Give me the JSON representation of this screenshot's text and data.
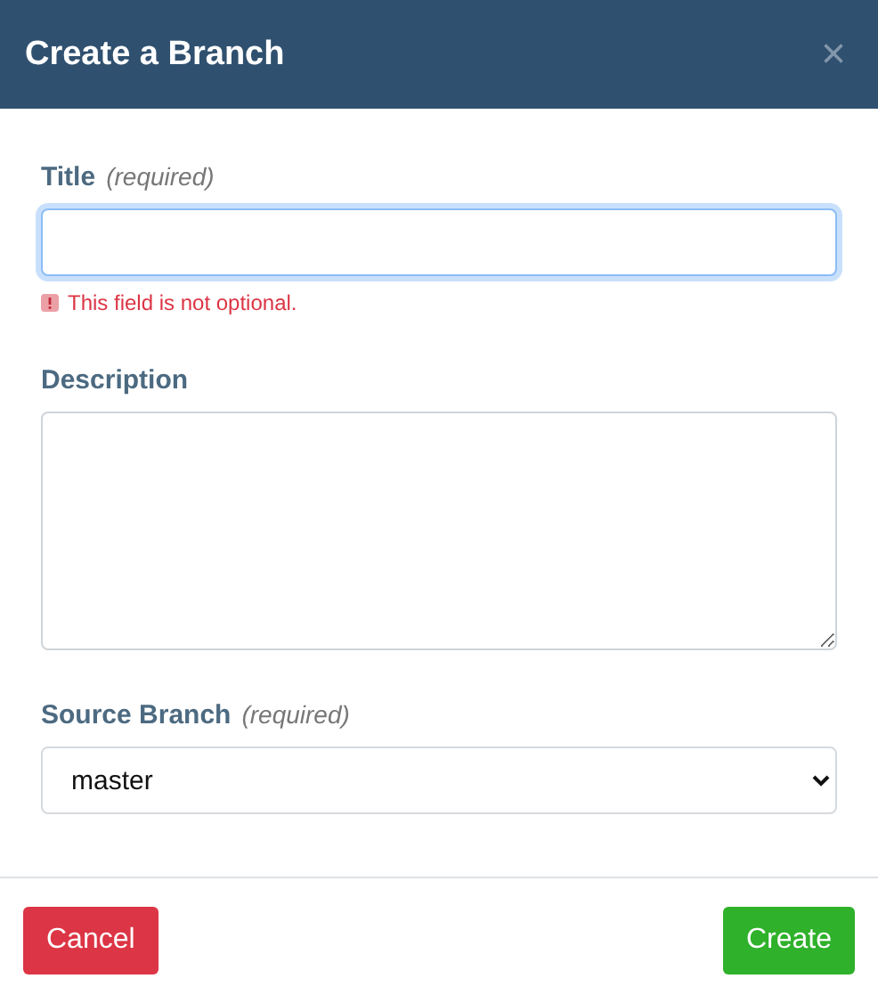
{
  "dialog": {
    "title": "Create a Branch",
    "close": "×"
  },
  "fields": [
    {
      "kind": "text",
      "label": "Title",
      "hint": "(required)",
      "focused": true,
      "error": "This field is not optional."
    },
    {
      "kind": "textarea",
      "label": "Description",
      "focused": false
    },
    {
      "kind": "select",
      "label": "Source Branch",
      "hint": "(required)",
      "value": "master",
      "focused": false
    }
  ],
  "buttons": [
    {
      "label": "Cancel",
      "kind": "danger"
    },
    {
      "label": "Create",
      "kind": "success"
    }
  ]
}
